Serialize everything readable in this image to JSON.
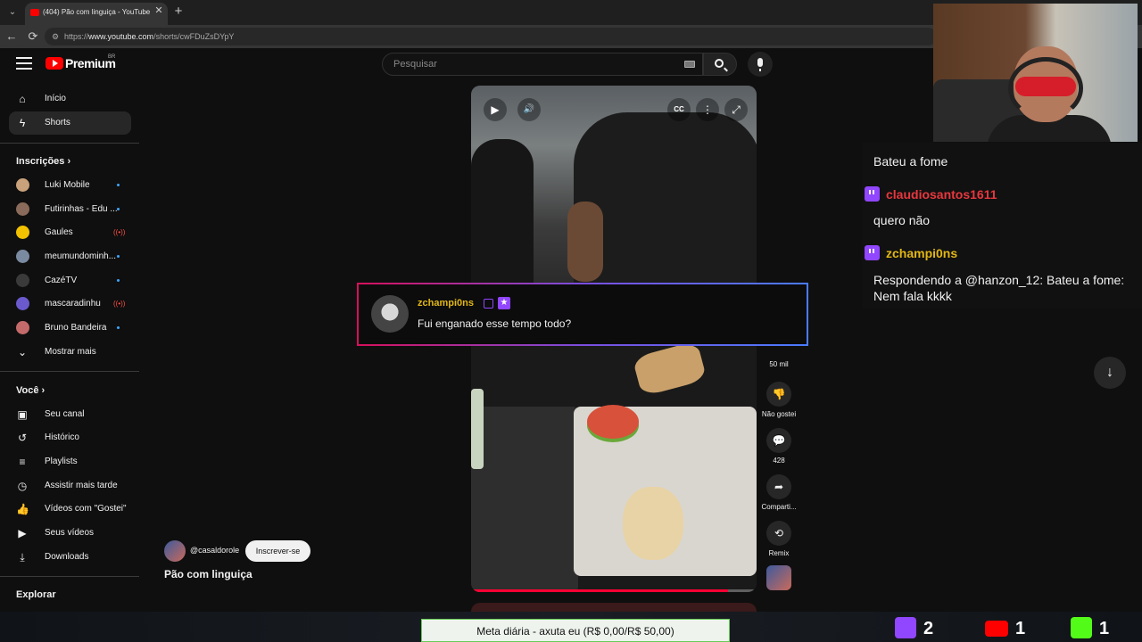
{
  "browser": {
    "tab_title": "(404) Pão com linguiça - YouTube",
    "close_glyph": "✕",
    "new_tab_glyph": "+",
    "back_glyph": "←",
    "reload_glyph": "⟳",
    "url_prefix": "https://",
    "url_host": "www.youtube.com",
    "url_path": "/shorts/cwFDuZsDYpY"
  },
  "masthead": {
    "brand": "Premium",
    "region": "BR",
    "search_placeholder": "Pesquisar"
  },
  "sidebar": {
    "home": "Início",
    "shorts": "Shorts",
    "subscriptions_header": "Inscrições",
    "subscriptions": [
      {
        "label": "Luki Mobile",
        "status": "new"
      },
      {
        "label": "Futirinhas - Edu ...",
        "status": "new"
      },
      {
        "label": "Gaules",
        "status": "live"
      },
      {
        "label": "meumundominh...",
        "status": "new"
      },
      {
        "label": "CazéTV",
        "status": "new"
      },
      {
        "label": "mascaradinhu",
        "status": "live"
      },
      {
        "label": "Bruno Bandeira",
        "status": "new"
      }
    ],
    "show_more": "Mostrar mais",
    "you_header": "Você",
    "you_items": [
      "Seu canal",
      "Histórico",
      "Playlists",
      "Assistir mais tarde",
      "Vídeos com \"Gostei\"",
      "Seus vídeos",
      "Downloads"
    ],
    "explore_header": "Explorar"
  },
  "short": {
    "channel": "@casaldorole",
    "subscribe": "Inscrever-se",
    "title": "Pão com linguiça",
    "progress_fraction": 0.9
  },
  "actions": {
    "likes": "50 mil",
    "dislike": "Não gostei",
    "comments": "428",
    "share": "Comparti...",
    "remix": "Remix"
  },
  "overlay_comment": {
    "user": "zchampi0ns",
    "text": "Fui enganado esse tempo todo?"
  },
  "chat": [
    {
      "user": "",
      "text": "Bateu a fome"
    },
    {
      "user": "claudiosantos1611",
      "user_color": "#e8373e",
      "text": "quero não"
    },
    {
      "user": "zchampi0ns",
      "user_color": "#e2b714",
      "text": "Respondendo a @hanzon_12: Bateu a fome: Nem fala kkkk"
    }
  ],
  "goal": "Meta diária - axuta eu (R$ 0,00/R$ 50,00)",
  "counters": {
    "twitch": "2",
    "youtube": "1",
    "kick": "1"
  },
  "icons": {
    "play": "▶",
    "volume": "🔊",
    "cc": "CC",
    "more": "⋮",
    "expand": "⤢",
    "dislike": "👎",
    "comment": "💬",
    "share": "➦",
    "remix": "⟲",
    "scroll_down": "↓",
    "star": "★"
  },
  "colors": {
    "youtube_red": "#ff0000",
    "twitch_purple": "#9146ff",
    "kick_green": "#53fc18",
    "goal_border": "#66cc55"
  }
}
